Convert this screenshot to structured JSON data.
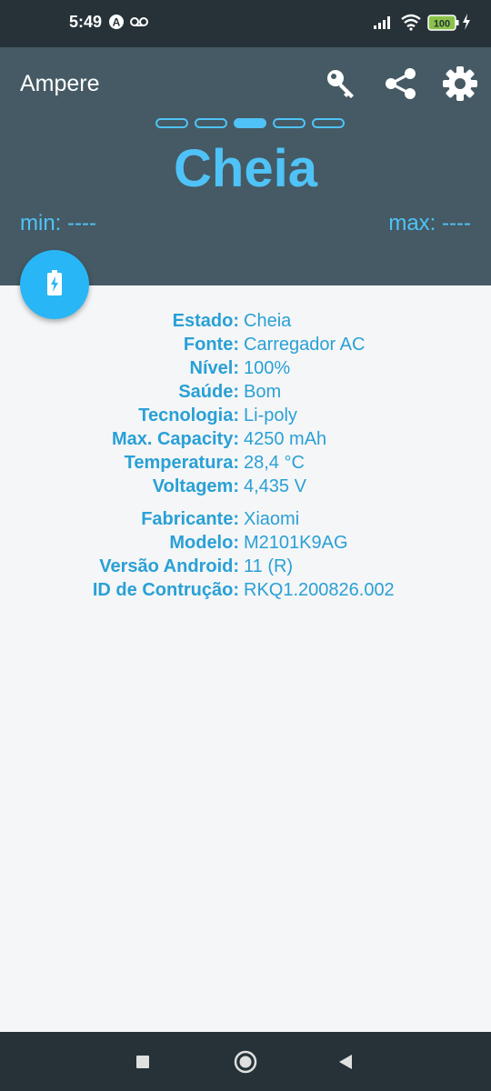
{
  "status_bar": {
    "time": "5:49",
    "battery_level": "100",
    "icons": [
      "auto-icon",
      "voicemail-icon",
      "signal-icon",
      "wifi-icon",
      "battery-icon",
      "charging-icon"
    ]
  },
  "header": {
    "app_title": "Ampere",
    "buttons": [
      "key-icon",
      "share-icon",
      "settings-icon"
    ],
    "status": "Cheia",
    "min_label": "min: ----",
    "max_label": "max: ----",
    "page_indicator_total": 5,
    "page_indicator_active": 3
  },
  "colors": {
    "accent": "#4fc3f7",
    "header_bg": "#455a64",
    "statusbar_bg": "#263238",
    "body_bg": "#f5f6f7"
  },
  "info_group_1": [
    {
      "label": "Estado:",
      "value": "Cheia"
    },
    {
      "label": "Fonte:",
      "value": "Carregador AC"
    },
    {
      "label": "Nível:",
      "value": "100%"
    },
    {
      "label": "Saúde:",
      "value": "Bom"
    },
    {
      "label": "Tecnologia:",
      "value": "Li-poly"
    },
    {
      "label": "Max. Capacity:",
      "value": "4250 mAh"
    },
    {
      "label": "Temperatura:",
      "value": "28,4 °C"
    },
    {
      "label": "Voltagem:",
      "value": "4,435 V"
    }
  ],
  "info_group_2": [
    {
      "label": "Fabricante:",
      "value": "Xiaomi"
    },
    {
      "label": "Modelo:",
      "value": "M2101K9AG"
    },
    {
      "label": "Versão Android:",
      "value": "11 (R)"
    },
    {
      "label": "ID de Contrução:",
      "value": "RKQ1.200826.002"
    }
  ]
}
